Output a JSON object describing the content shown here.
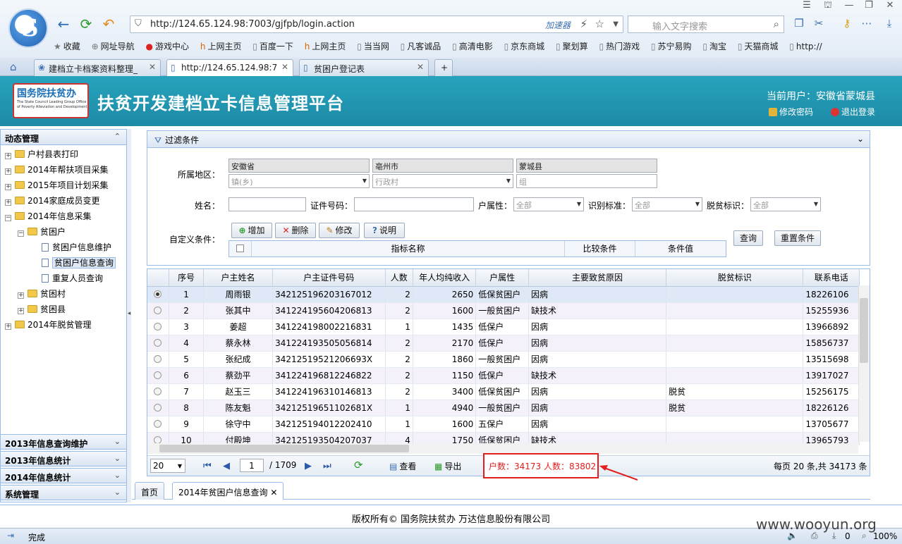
{
  "browser": {
    "url": "http://124.65.124.98:7003/gjfpb/login.action",
    "accelerator": "加速器",
    "search_placeholder": "输入文字搜索",
    "favorites": [
      "收藏",
      "网址导航",
      "游戏中心",
      "上网主页",
      "百度一下",
      "上网主页",
      "当当网",
      "凡客诚品",
      "高清电影",
      "京东商城",
      "聚划算",
      "热门游戏",
      "苏宁易购",
      "淘宝",
      "天猫商城",
      "http://"
    ],
    "tabs": [
      {
        "label": "建档立卡档案资料整理_"
      },
      {
        "label": "http://124.65.124.98:7"
      },
      {
        "label": "贫困户登记表"
      }
    ],
    "status": "完成",
    "zoom": "100%",
    "dl_count": "0"
  },
  "app": {
    "logo_text": "国务院扶贫办",
    "logo_subtext": "The State Council Leading Group Office of Poverty Alleviation and Development",
    "title": "扶贫开发建档立卡信息管理平台",
    "current_user": "当前用户：安徽省蒙城县",
    "change_password": "修改密码",
    "logout": "退出登录"
  },
  "sidebar": {
    "sections": [
      {
        "label": "动态管理"
      },
      {
        "label": "2013年信息查询维护"
      },
      {
        "label": "2013年信息统计"
      },
      {
        "label": "2014年信息统计"
      },
      {
        "label": "系统管理"
      }
    ],
    "tree": [
      {
        "label": "户村县表打印"
      },
      {
        "label": "2014年帮扶项目采集"
      },
      {
        "label": "2015年项目计划采集"
      },
      {
        "label": "2014家庭成员变更"
      },
      {
        "label": "2014年信息采集"
      },
      {
        "label": "贫困户"
      },
      {
        "label": "贫困户信息维护"
      },
      {
        "label": "贫困户信息查询"
      },
      {
        "label": "重复人员查询"
      },
      {
        "label": "贫困村"
      },
      {
        "label": "贫困县"
      },
      {
        "label": "2014年脱贫管理"
      }
    ]
  },
  "filter": {
    "title": "过滤条件",
    "region_label": "所属地区：",
    "province": "安徽省",
    "city": "亳州市",
    "county": "蒙城县",
    "town_placeholder": "镇(乡)",
    "village_placeholder": "行政村",
    "group_placeholder": "组",
    "name_label": "姓名：",
    "id_label": "证件号码：",
    "hushuxing_label": "户属性：",
    "standard_label": "识别标准：",
    "tuopin_label": "脱贫标识：",
    "all": "全部",
    "custom_label": "自定义条件：",
    "add": "增加",
    "delete": "删除",
    "edit": "修改",
    "explain": "说明",
    "query": "查询",
    "reset": "重置条件",
    "cond_cols": [
      "指标名称",
      "比较条件",
      "条件值"
    ]
  },
  "grid": {
    "columns": [
      "序号",
      "户主姓名",
      "户主证件号码",
      "人数",
      "年人均纯收入",
      "户属性",
      "主要致贫原因",
      "脱贫标识",
      "联系电话"
    ],
    "rows": [
      [
        "1",
        "周雨银",
        "342125196203167012",
        "2",
        "2650",
        "低保贫困户",
        "因病",
        "",
        "18226106"
      ],
      [
        "2",
        "张其中",
        "341224195604206813",
        "2",
        "1600",
        "一般贫困户",
        "缺技术",
        "",
        "15255936"
      ],
      [
        "3",
        "姜超",
        "341224198002216831",
        "1",
        "1435",
        "低保户",
        "因病",
        "",
        "13966892"
      ],
      [
        "4",
        "蔡永林",
        "341224193505056814",
        "2",
        "2170",
        "低保户",
        "因病",
        "",
        "15856737"
      ],
      [
        "5",
        "张纪成",
        "34212519521206693X",
        "2",
        "1860",
        "一般贫困户",
        "因病",
        "",
        "13515698"
      ],
      [
        "6",
        "蔡劲平",
        "341224196812246822",
        "2",
        "1150",
        "低保户",
        "缺技术",
        "",
        "13917027"
      ],
      [
        "7",
        "赵玉三",
        "341224196310146813",
        "2",
        "3400",
        "低保贫困户",
        "因病",
        "脱贫",
        "15256175"
      ],
      [
        "8",
        "陈友魁",
        "34212519651102681X",
        "1",
        "4940",
        "一般贫困户",
        "因病",
        "脱贫",
        "18226126"
      ],
      [
        "9",
        "徐守中",
        "342125194012202410",
        "1",
        "1600",
        "五保户",
        "因病",
        "",
        "13705677"
      ],
      [
        "10",
        "付殿坤",
        "342125193504207037",
        "4",
        "1750",
        "低保贫困户",
        "缺技术",
        "",
        "13965793"
      ]
    ]
  },
  "pager": {
    "page_size": "20",
    "page": "1",
    "total_pages": "/ 1709",
    "view": "查看",
    "export": "导出",
    "stats": "户数：34173 人数：83802",
    "info": "每页 20 条,共 34173 条"
  },
  "bottom_tabs": [
    {
      "label": "首页"
    },
    {
      "label": "2014年贫困户信息查询"
    }
  ],
  "footer": "版权所有© 国务院扶贫办 万达信息股份有限公司",
  "watermark": "www.wooyun.org"
}
